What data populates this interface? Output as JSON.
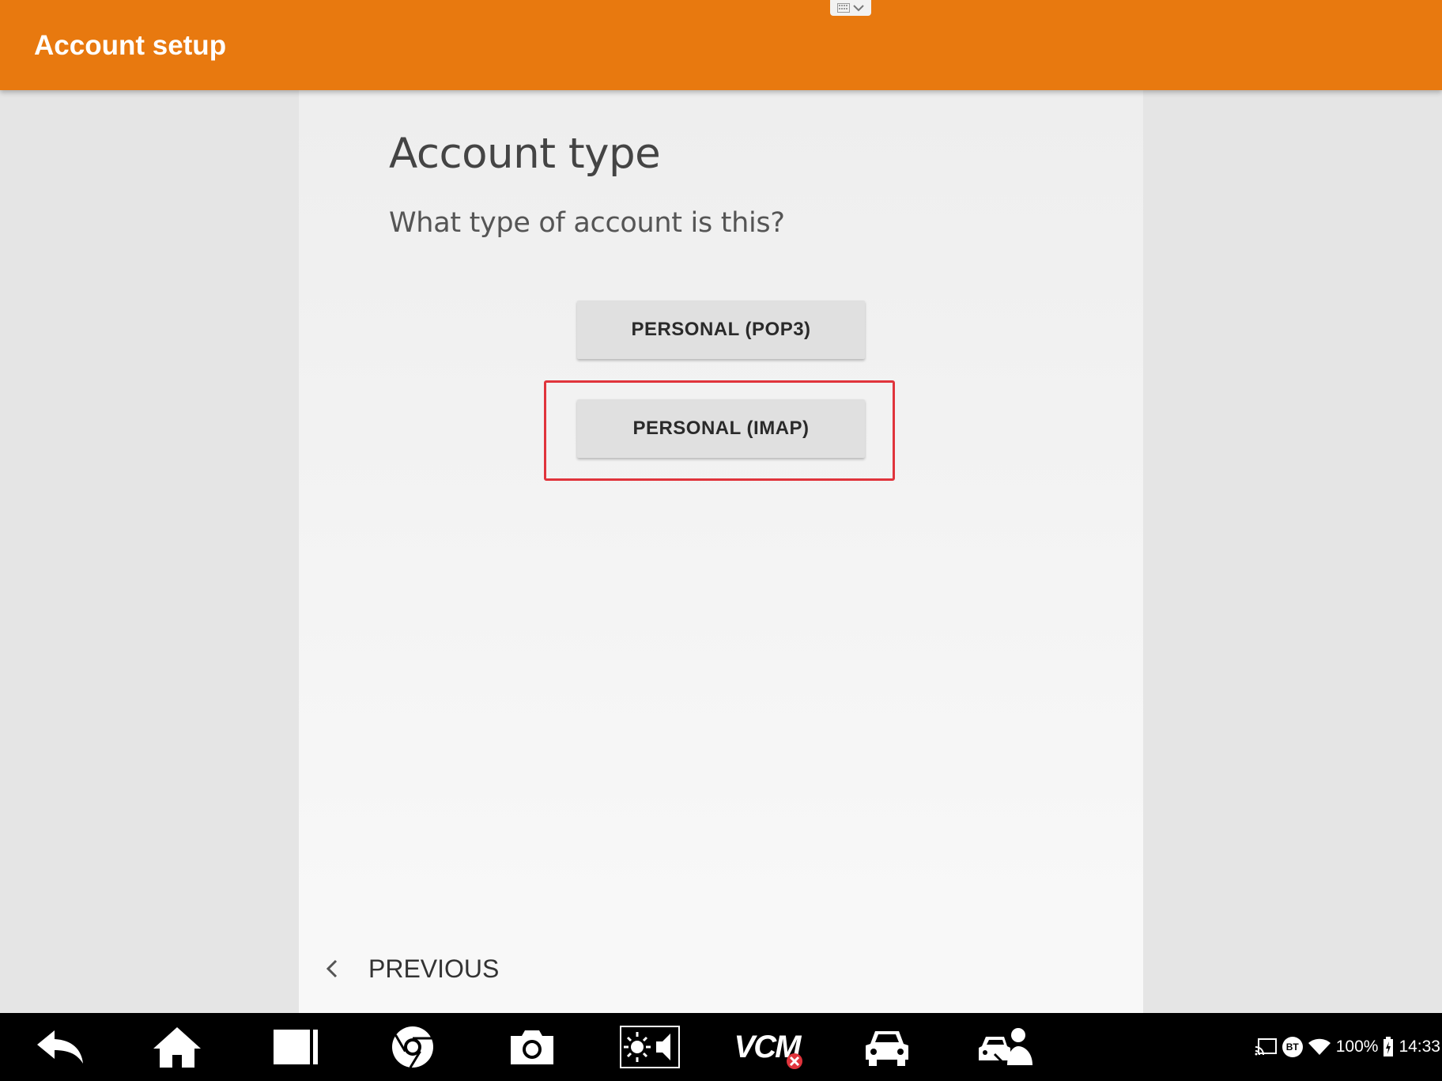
{
  "appbar": {
    "title": "Account setup"
  },
  "content": {
    "heading": "Account type",
    "subheading": "What type of account is this?",
    "options": [
      {
        "label": "PERSONAL (POP3)"
      },
      {
        "label": "PERSONAL (IMAP)",
        "highlighted": true
      }
    ]
  },
  "footer": {
    "previous_label": "PREVIOUS"
  },
  "navbar": {
    "icons": [
      "back-icon",
      "home-icon",
      "recent-apps-icon",
      "chrome-icon",
      "camera-icon",
      "brightness-volume-icon",
      "vcm-icon",
      "car-icon",
      "car-service-icon"
    ],
    "vcm_label": "VCM"
  },
  "status_bar": {
    "battery": "100%",
    "time": "14:33",
    "bluetooth_label": "BT"
  },
  "colors": {
    "appbar": "#e8790f",
    "highlight_border": "#e0343c",
    "button_bg": "#e0e0e0"
  }
}
